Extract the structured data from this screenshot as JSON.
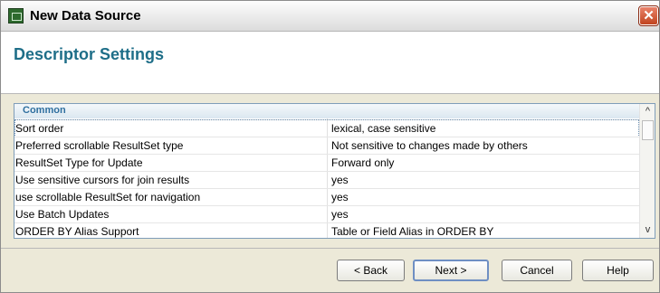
{
  "window": {
    "title": "New Data Source",
    "close_glyph": "✕"
  },
  "header": {
    "title": "Descriptor Settings",
    "subtitle": ""
  },
  "grid": {
    "section": "Common",
    "rows": [
      {
        "name": "Sort order",
        "value": "lexical, case sensitive"
      },
      {
        "name": "Preferred scrollable ResultSet type",
        "value": "Not sensitive to changes made by others"
      },
      {
        "name": "ResultSet Type for Update",
        "value": "Forward only"
      },
      {
        "name": "Use sensitive cursors for join results",
        "value": "yes"
      },
      {
        "name": "use scrollable ResultSet for navigation",
        "value": "yes"
      },
      {
        "name": "Use Batch Updates",
        "value": "yes"
      },
      {
        "name": "ORDER BY Alias Support",
        "value": "Table or Field Alias in ORDER BY"
      }
    ],
    "scroll_up": "^",
    "scroll_down": "v"
  },
  "buttons": {
    "back": "< Back",
    "next": "Next >",
    "cancel": "Cancel",
    "help": "Help"
  }
}
